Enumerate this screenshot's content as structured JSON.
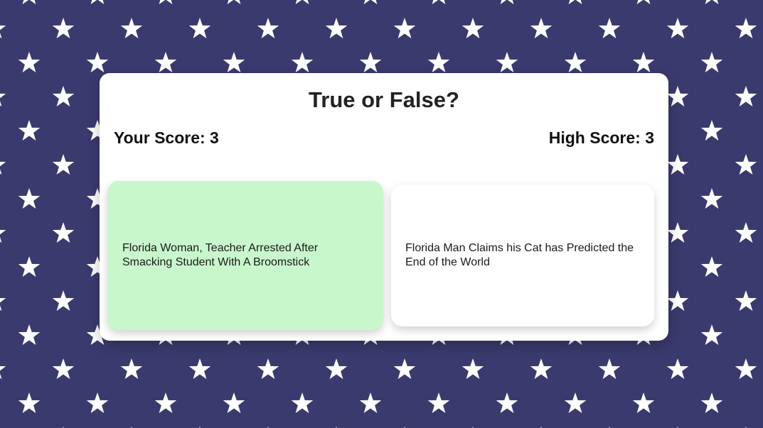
{
  "title": "True or False?",
  "score": {
    "your_label": "Your Score: 3",
    "high_label": "High Score: 3",
    "your_value": 3,
    "high_value": 3
  },
  "cards": [
    {
      "headline": "Florida Woman, Teacher Arrested After Smacking Student With A Broomstick",
      "state": "selected-correct"
    },
    {
      "headline": "Florida Man Claims his Cat has Predicted the End of the World",
      "state": "unselected"
    }
  ],
  "colors": {
    "background": "#3b3a6e",
    "stars": "#ffffff",
    "panel": "#ffffff",
    "correct_card": "#c8f7cc"
  }
}
